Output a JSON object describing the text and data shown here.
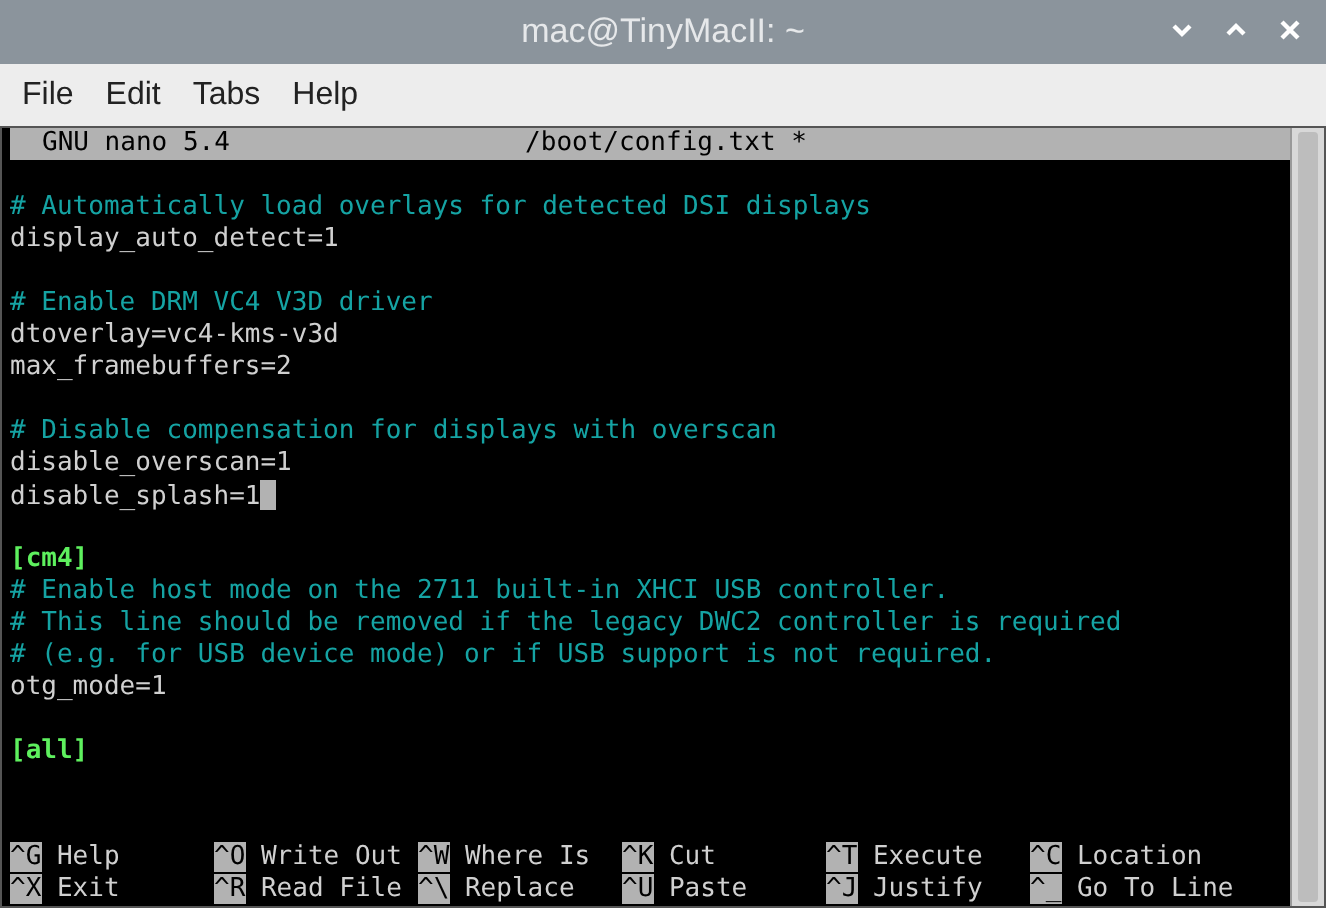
{
  "window": {
    "title": "mac@TinyMacII: ~"
  },
  "menu": [
    "File",
    "Edit",
    "Tabs",
    "Help"
  ],
  "nano_header": {
    "version": "GNU nano 5.4",
    "filename": "/boot/config.txt *"
  },
  "lines": [
    {
      "kind": "blank"
    },
    {
      "kind": "comment",
      "text": "# Automatically load overlays for detected DSI displays"
    },
    {
      "kind": "setting",
      "text": "display_auto_detect=1"
    },
    {
      "kind": "blank"
    },
    {
      "kind": "comment",
      "text": "# Enable DRM VC4 V3D driver"
    },
    {
      "kind": "setting",
      "text": "dtoverlay=vc4-kms-v3d"
    },
    {
      "kind": "setting",
      "text": "max_framebuffers=2"
    },
    {
      "kind": "blank"
    },
    {
      "kind": "comment",
      "text": "# Disable compensation for displays with overscan"
    },
    {
      "kind": "setting",
      "text": "disable_overscan=1"
    },
    {
      "kind": "setting",
      "text": "disable_splash=1",
      "cursor": true
    },
    {
      "kind": "blank"
    },
    {
      "kind": "section",
      "text": "[cm4]"
    },
    {
      "kind": "comment",
      "text": "# Enable host mode on the 2711 built-in XHCI USB controller."
    },
    {
      "kind": "comment",
      "text": "# This line should be removed if the legacy DWC2 controller is required"
    },
    {
      "kind": "comment",
      "text": "# (e.g. for USB device mode) or if USB support is not required."
    },
    {
      "kind": "setting",
      "text": "otg_mode=1"
    },
    {
      "kind": "blank"
    },
    {
      "kind": "section",
      "text": "[all]"
    },
    {
      "kind": "blank"
    },
    {
      "kind": "blank"
    }
  ],
  "shortcuts": [
    [
      {
        "key": "^G",
        "label": "Help"
      },
      {
        "key": "^O",
        "label": "Write Out"
      },
      {
        "key": "^W",
        "label": "Where Is"
      },
      {
        "key": "^K",
        "label": "Cut"
      },
      {
        "key": "^T",
        "label": "Execute"
      },
      {
        "key": "^C",
        "label": "Location"
      }
    ],
    [
      {
        "key": "^X",
        "label": "Exit"
      },
      {
        "key": "^R",
        "label": "Read File"
      },
      {
        "key": "^\\",
        "label": "Replace"
      },
      {
        "key": "^U",
        "label": "Paste"
      },
      {
        "key": "^J",
        "label": "Justify"
      },
      {
        "key": "^_",
        "label": "Go To Line"
      }
    ]
  ]
}
